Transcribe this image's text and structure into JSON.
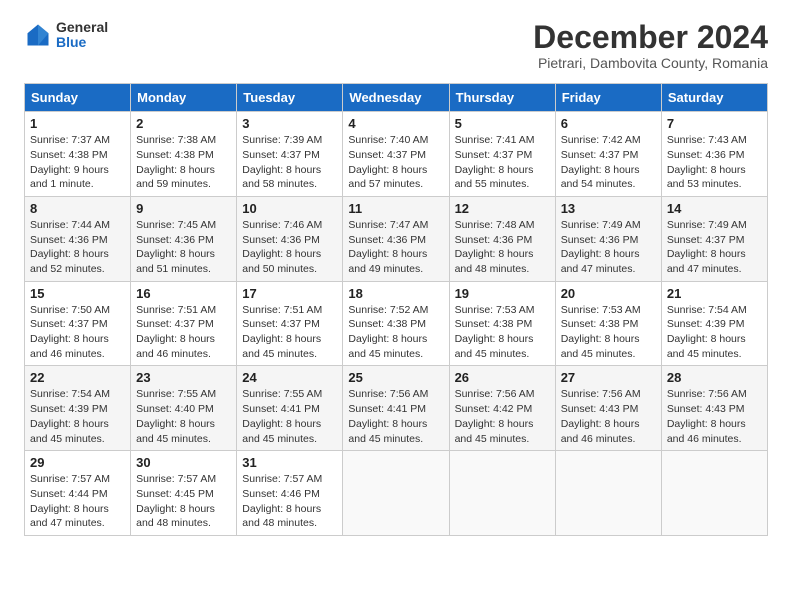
{
  "logo": {
    "general": "General",
    "blue": "Blue"
  },
  "title": "December 2024",
  "subtitle": "Pietrari, Dambovita County, Romania",
  "weekdays": [
    "Sunday",
    "Monday",
    "Tuesday",
    "Wednesday",
    "Thursday",
    "Friday",
    "Saturday"
  ],
  "weeks": [
    [
      {
        "day": "1",
        "detail": "Sunrise: 7:37 AM\nSunset: 4:38 PM\nDaylight: 9 hours\nand 1 minute."
      },
      {
        "day": "2",
        "detail": "Sunrise: 7:38 AM\nSunset: 4:38 PM\nDaylight: 8 hours\nand 59 minutes."
      },
      {
        "day": "3",
        "detail": "Sunrise: 7:39 AM\nSunset: 4:37 PM\nDaylight: 8 hours\nand 58 minutes."
      },
      {
        "day": "4",
        "detail": "Sunrise: 7:40 AM\nSunset: 4:37 PM\nDaylight: 8 hours\nand 57 minutes."
      },
      {
        "day": "5",
        "detail": "Sunrise: 7:41 AM\nSunset: 4:37 PM\nDaylight: 8 hours\nand 55 minutes."
      },
      {
        "day": "6",
        "detail": "Sunrise: 7:42 AM\nSunset: 4:37 PM\nDaylight: 8 hours\nand 54 minutes."
      },
      {
        "day": "7",
        "detail": "Sunrise: 7:43 AM\nSunset: 4:36 PM\nDaylight: 8 hours\nand 53 minutes."
      }
    ],
    [
      {
        "day": "8",
        "detail": "Sunrise: 7:44 AM\nSunset: 4:36 PM\nDaylight: 8 hours\nand 52 minutes."
      },
      {
        "day": "9",
        "detail": "Sunrise: 7:45 AM\nSunset: 4:36 PM\nDaylight: 8 hours\nand 51 minutes."
      },
      {
        "day": "10",
        "detail": "Sunrise: 7:46 AM\nSunset: 4:36 PM\nDaylight: 8 hours\nand 50 minutes."
      },
      {
        "day": "11",
        "detail": "Sunrise: 7:47 AM\nSunset: 4:36 PM\nDaylight: 8 hours\nand 49 minutes."
      },
      {
        "day": "12",
        "detail": "Sunrise: 7:48 AM\nSunset: 4:36 PM\nDaylight: 8 hours\nand 48 minutes."
      },
      {
        "day": "13",
        "detail": "Sunrise: 7:49 AM\nSunset: 4:36 PM\nDaylight: 8 hours\nand 47 minutes."
      },
      {
        "day": "14",
        "detail": "Sunrise: 7:49 AM\nSunset: 4:37 PM\nDaylight: 8 hours\nand 47 minutes."
      }
    ],
    [
      {
        "day": "15",
        "detail": "Sunrise: 7:50 AM\nSunset: 4:37 PM\nDaylight: 8 hours\nand 46 minutes."
      },
      {
        "day": "16",
        "detail": "Sunrise: 7:51 AM\nSunset: 4:37 PM\nDaylight: 8 hours\nand 46 minutes."
      },
      {
        "day": "17",
        "detail": "Sunrise: 7:51 AM\nSunset: 4:37 PM\nDaylight: 8 hours\nand 45 minutes."
      },
      {
        "day": "18",
        "detail": "Sunrise: 7:52 AM\nSunset: 4:38 PM\nDaylight: 8 hours\nand 45 minutes."
      },
      {
        "day": "19",
        "detail": "Sunrise: 7:53 AM\nSunset: 4:38 PM\nDaylight: 8 hours\nand 45 minutes."
      },
      {
        "day": "20",
        "detail": "Sunrise: 7:53 AM\nSunset: 4:38 PM\nDaylight: 8 hours\nand 45 minutes."
      },
      {
        "day": "21",
        "detail": "Sunrise: 7:54 AM\nSunset: 4:39 PM\nDaylight: 8 hours\nand 45 minutes."
      }
    ],
    [
      {
        "day": "22",
        "detail": "Sunrise: 7:54 AM\nSunset: 4:39 PM\nDaylight: 8 hours\nand 45 minutes."
      },
      {
        "day": "23",
        "detail": "Sunrise: 7:55 AM\nSunset: 4:40 PM\nDaylight: 8 hours\nand 45 minutes."
      },
      {
        "day": "24",
        "detail": "Sunrise: 7:55 AM\nSunset: 4:41 PM\nDaylight: 8 hours\nand 45 minutes."
      },
      {
        "day": "25",
        "detail": "Sunrise: 7:56 AM\nSunset: 4:41 PM\nDaylight: 8 hours\nand 45 minutes."
      },
      {
        "day": "26",
        "detail": "Sunrise: 7:56 AM\nSunset: 4:42 PM\nDaylight: 8 hours\nand 45 minutes."
      },
      {
        "day": "27",
        "detail": "Sunrise: 7:56 AM\nSunset: 4:43 PM\nDaylight: 8 hours\nand 46 minutes."
      },
      {
        "day": "28",
        "detail": "Sunrise: 7:56 AM\nSunset: 4:43 PM\nDaylight: 8 hours\nand 46 minutes."
      }
    ],
    [
      {
        "day": "29",
        "detail": "Sunrise: 7:57 AM\nSunset: 4:44 PM\nDaylight: 8 hours\nand 47 minutes."
      },
      {
        "day": "30",
        "detail": "Sunrise: 7:57 AM\nSunset: 4:45 PM\nDaylight: 8 hours\nand 48 minutes."
      },
      {
        "day": "31",
        "detail": "Sunrise: 7:57 AM\nSunset: 4:46 PM\nDaylight: 8 hours\nand 48 minutes."
      },
      {
        "day": "",
        "detail": ""
      },
      {
        "day": "",
        "detail": ""
      },
      {
        "day": "",
        "detail": ""
      },
      {
        "day": "",
        "detail": ""
      }
    ]
  ]
}
